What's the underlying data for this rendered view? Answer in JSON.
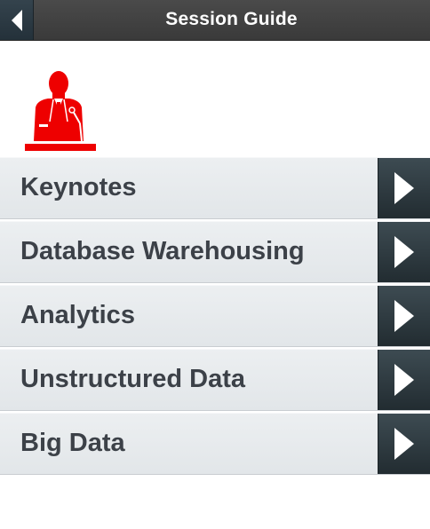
{
  "header": {
    "title": "Session Guide",
    "back_icon": "chevron-left-icon"
  },
  "hero": {
    "icon": "speaker-podium-icon",
    "icon_color": "#ee0000"
  },
  "sessions": [
    {
      "label": "Keynotes",
      "icon": "chevron-right-icon"
    },
    {
      "label": "Database Warehousing",
      "icon": "chevron-right-icon"
    },
    {
      "label": "Analytics",
      "icon": "chevron-right-icon"
    },
    {
      "label": "Unstructured Data",
      "icon": "chevron-right-icon"
    },
    {
      "label": "Big Data",
      "icon": "chevron-right-icon"
    }
  ],
  "colors": {
    "header_bg": "#404040",
    "back_button_bg": "#2c3a43",
    "list_bg": "#e6e9ec",
    "list_text": "#3c4148",
    "arrow_bg": "#2f3b41",
    "arrow_fg": "#ffffff"
  }
}
